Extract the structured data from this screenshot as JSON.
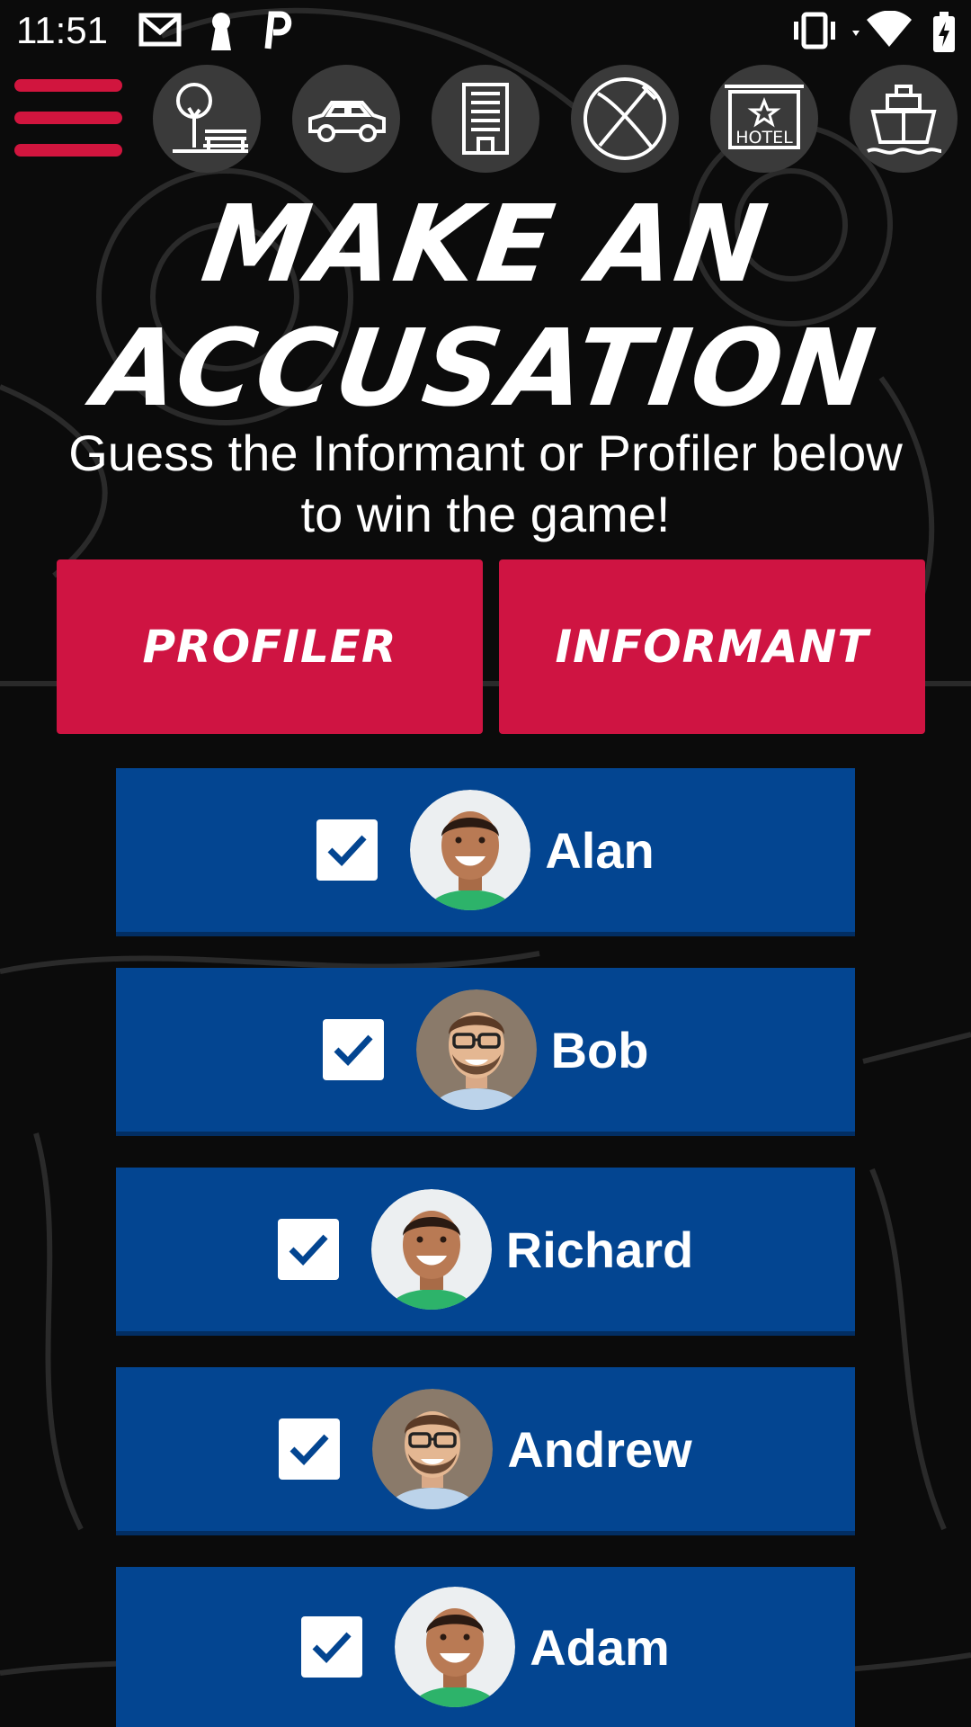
{
  "status_bar": {
    "time": "11:51",
    "left_icons": [
      "gmail-icon",
      "keyhole-icon",
      "parking-icon"
    ],
    "right_icons": [
      "vibrate-icon",
      "wifi-icon",
      "battery-charging-icon"
    ]
  },
  "nav": {
    "menu_icon": "hamburger-menu-icon",
    "locations": [
      {
        "id": "park",
        "icon": "park-bench-icon"
      },
      {
        "id": "car",
        "icon": "car-icon"
      },
      {
        "id": "office",
        "icon": "office-building-icon"
      },
      {
        "id": "restaurant",
        "icon": "fork-knife-icon"
      },
      {
        "id": "hotel",
        "icon": "hotel-sign-icon",
        "label": "HOTEL"
      },
      {
        "id": "ship",
        "icon": "ship-icon"
      }
    ]
  },
  "heading": {
    "line1": "MAKE AN",
    "line2": "ACCUSATION",
    "subtitle": "Guess the Informant or Profiler below to win the game!"
  },
  "roles": {
    "profiler": "PROFILER",
    "informant": "INFORMANT"
  },
  "suspects": [
    {
      "name": "Alan",
      "checked": true,
      "avatar": "green"
    },
    {
      "name": "Bob",
      "checked": true,
      "avatar": "glasses"
    },
    {
      "name": "Richard",
      "checked": true,
      "avatar": "green"
    },
    {
      "name": "Andrew",
      "checked": true,
      "avatar": "glasses"
    },
    {
      "name": "Adam",
      "checked": true,
      "avatar": "green"
    }
  ],
  "colors": {
    "accent_red": "#cf1442",
    "row_blue": "#034591",
    "background": "#0b0b0b"
  }
}
